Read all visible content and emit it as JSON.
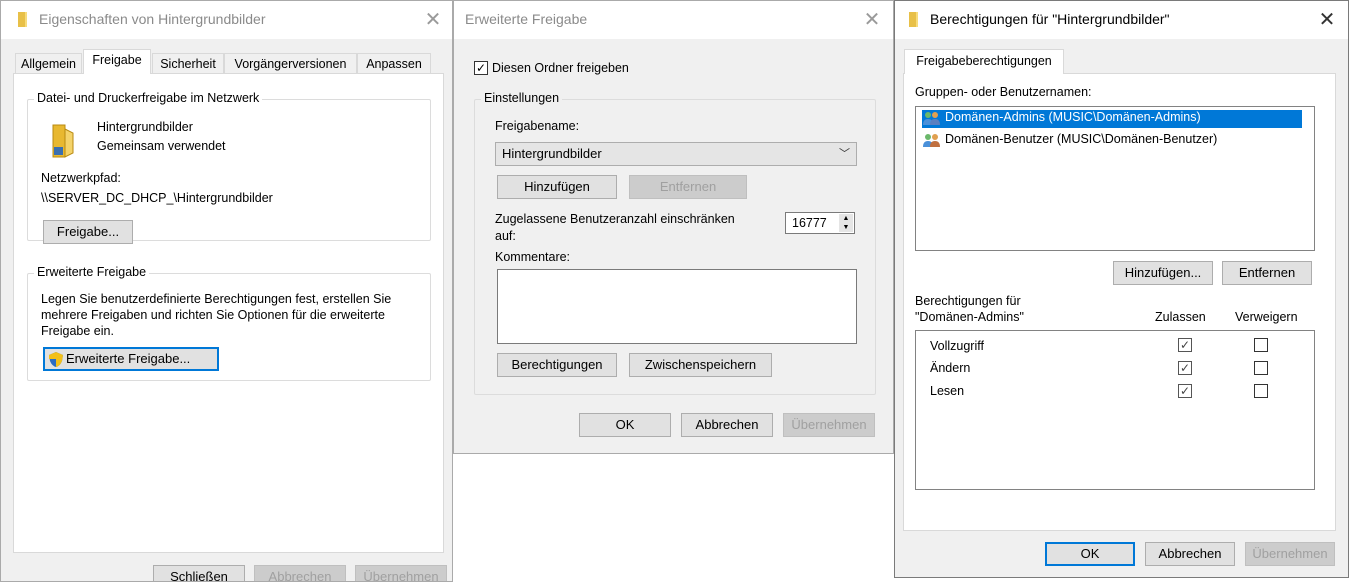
{
  "win1": {
    "title": "Eigenschaften von Hintergrundbilder",
    "tabs": [
      "Allgemein",
      "Freigabe",
      "Sicherheit",
      "Vorgängerversionen",
      "Anpassen"
    ],
    "group1_label": "Datei- und Druckerfreigabe im Netzwerk",
    "folder_name": "Hintergrundbilder",
    "folder_status": "Gemeinsam verwendet",
    "netpath_label": "Netzwerkpfad:",
    "netpath_value": "\\\\SERVER_DC_DHCP_\\Hintergrundbilder",
    "share_button": "Freigabe...",
    "group2_label": "Erweiterte Freigabe",
    "adv_desc": [
      "Legen Sie benutzerdefinierte Berechtigungen fest, erstellen Sie",
      "mehrere Freigaben und richten Sie Optionen für die erweiterte",
      "Freigabe ein."
    ],
    "adv_button": "Erweiterte Freigabe...",
    "close_button": "Schließen",
    "cancel_button": "Abbrechen",
    "apply_button": "Übernehmen"
  },
  "win2": {
    "title": "Erweiterte Freigabe",
    "share_checkbox_label": "Diesen Ordner freigeben",
    "settings_label": "Einstellungen",
    "sharename_label": "Freigabename:",
    "sharename_value": "Hintergrundbilder",
    "add_button": "Hinzufügen",
    "remove_button": "Entfernen",
    "limit_label_line1": "Zugelassene Benutzeranzahl einschränken",
    "limit_label_line2": "auf:",
    "limit_value": "16777",
    "comments_label": "Kommentare:",
    "permissions_button": "Berechtigungen",
    "caching_button": "Zwischenspeichern",
    "ok_button": "OK",
    "cancel_button": "Abbrechen",
    "apply_button": "Übernehmen"
  },
  "win3": {
    "title": "Berechtigungen für \"Hintergrundbilder\"",
    "tab": "Freigabeberechtigungen",
    "groups_label": "Gruppen- oder Benutzernamen:",
    "users": [
      "Domänen-Admins (MUSIC\\Domänen-Admins)",
      "Domänen-Benutzer (MUSIC\\Domänen-Benutzer)"
    ],
    "add_button": "Hinzufügen...",
    "remove_button": "Entfernen",
    "perms_label_line1": "Berechtigungen für",
    "perms_label_line2": "\"Domänen-Admins\"",
    "allow_label": "Zulassen",
    "deny_label": "Verweigern",
    "permissions": [
      {
        "name": "Vollzugriff",
        "allow": true,
        "deny": false
      },
      {
        "name": "Ändern",
        "allow": true,
        "deny": false
      },
      {
        "name": "Lesen",
        "allow": true,
        "deny": false
      }
    ],
    "ok_button": "OK",
    "cancel_button": "Abbrechen",
    "apply_button": "Übernehmen"
  },
  "icons": {
    "folder": "folder-icon",
    "share": "shared-folder-icon",
    "shield": "uac-shield-icon",
    "users": "user-group-icon"
  },
  "colors": {
    "selection": "#0078d7",
    "dialog_bg": "#f0f0f0"
  }
}
